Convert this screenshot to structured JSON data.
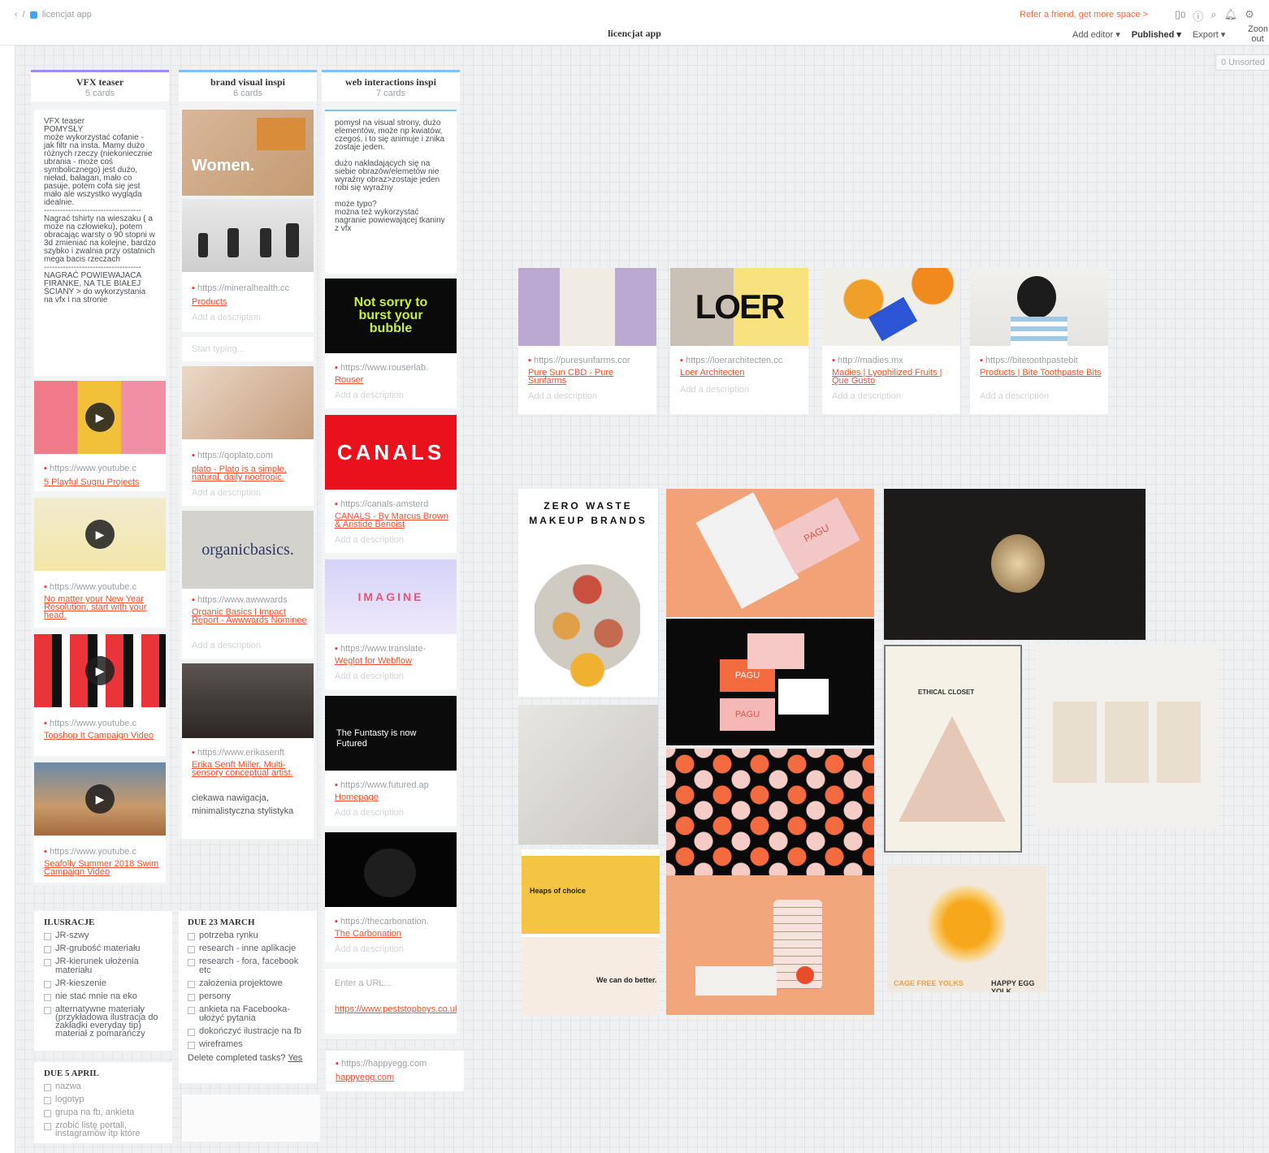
{
  "topbar": {
    "breadcrumb": "licencjat app",
    "title": "licencjat app",
    "refer": "Refer a friend, get more space >",
    "add_editor": "Add editor",
    "published": "Published",
    "export": "Export",
    "zoom": "Zoom out",
    "cards_count": "0",
    "unsorted": "0 Unsorted"
  },
  "col1": {
    "title": "VFX teaser",
    "count": "5 cards",
    "note1": "VFX teaser\nPOMYSŁY\nmoże wykorzystać cofanie - jak filtr na insta. Mamy dużo różnych rzeczy (niekoniecznie ubrania - może coś symbolicznego) jest dużo, nieład, bałagan, mało co pasuje, potem cofa się jest mało ale wszystko wygląda idealnie.\n------------------------------------\nNagrać tshirty na wieszaku ( a może na człowieku), potem obracając warsty o 90 stopni w 3d zmieniać na kolejne, bardzo szybko i zwalnia przy ostatnich mega bacis rzeczach\n------------------------------------\nNAGRAĆ POWIEWAJACA FIRANKE, NA TLE BIAŁEJ ŚCIANY > do wykorzystania na vfx i na stronie",
    "videos": [
      {
        "url": "https://www.youtube.c",
        "title": "5 Playful Sugru Projects"
      },
      {
        "url": "https://www.youtube.c",
        "title": "No matter your New Year Resolution, start with your head."
      },
      {
        "url": "https://www.youtube.c",
        "title": "Topshop It Campaign Video"
      },
      {
        "url": "https://www.youtube.c",
        "title": "Seafolly Summer 2018 Swim Campaign Video"
      }
    ]
  },
  "col2": {
    "title": "brand visual inspi",
    "count": "6 cards",
    "women": "Women.",
    "cards": [
      {
        "url": "https://mineralhealth.cc",
        "title": "Products",
        "desc": "Add a description"
      },
      {
        "url": "https://qoplato.com",
        "title": "plato - Plato is a simple, natural, daily nootropic.",
        "desc": "Add a description"
      },
      {
        "url": "https://www.awwwards",
        "title": "Organic Basics | Impact Report - Awwwards Nominee",
        "desc": "Add a description"
      },
      {
        "url": "https://www.erikasenft",
        "title": "Erika Senft Miller. Multi-sensory conceptual artist.",
        "extra": "ciekawa nawigacja, minimalistyczna stylistyka"
      }
    ],
    "start": "Start typing...",
    "organic": "organicbasics."
  },
  "col3": {
    "title": "web interactions inspi",
    "count": "7 cards",
    "note": "pomysł na visual strony, dużo elementów, może np kwiatów, czegoś, i to się animuje i znika zostaje jeden.\n\ndużo nakładających się na siebie obrazów/elemetów nie wyraźny obraz>zostaje jeden robi się wyraźny\n\nmoże typo?\nmożna też wykorzystać nagranie powiewającej tkaniny z vfx",
    "notsorry": "Not sorry to burst your bubble",
    "canals": "CANALS",
    "imagine": "IMAGINE",
    "futured": "The Funtasty is now Futured",
    "cards": [
      {
        "url": "https://www.rouserlab.",
        "title": "Rouser",
        "desc": "Add a description"
      },
      {
        "url": "https://canals-amsterd",
        "title": "CANALS - By Marcus Brown & Aristide Benoist",
        "desc": "Add a description"
      },
      {
        "url": "https://www.translate-",
        "title": "Weglot for Webflow",
        "desc": "Add a description"
      },
      {
        "url": "https://www.futured.ap",
        "title": "Homepage",
        "desc": "Add a description"
      },
      {
        "url": "https://thecarbonation.",
        "title": "The Carbonation",
        "desc": "Add a description"
      }
    ],
    "enter_url": "Enter a URL...",
    "peststop": "https://www.peststopboys.co.uk"
  },
  "happyegg": {
    "url": "https://happyegg.com",
    "title": "happyegg.com"
  },
  "tasks1": {
    "title": "ILUSRACJE",
    "items": [
      "JR-szwy",
      "JR-grubość materiału",
      "JR-kierunek ułożenia materiału",
      "JR-kieszenie",
      "nie stać mnie na eko",
      "alternatywne materiały (przykładowa ilustracja do zakładki everyday tip) materiał z pomarańczy"
    ]
  },
  "tasks2": {
    "title": "DUE 23 MARCH",
    "items": [
      "potrzeba rynku",
      "research - inne aplikacje",
      "research - fora, facebook etc",
      "założenia projektowe",
      "persony",
      "ankieta na Facebooka-ułożyć pytania",
      "dokończyć ilustracje na fb",
      "wireframes"
    ],
    "delete": "Delete completed tasks?",
    "yes": "Yes"
  },
  "tasks3": {
    "title": "DUE 5 APRIL",
    "items": [
      "nazwa",
      "logotyp",
      "grupa na fb, ankieta",
      "zrobić listę portali, instagramów itp które"
    ]
  },
  "bookmarks": [
    {
      "url": "https://puresunfarms.cor",
      "title": "Pure Sun CBD - Pure Sunfarms",
      "desc": "Add a description"
    },
    {
      "url": "https://loerarchitecten.cc",
      "title": "Loer Architecten",
      "desc": "Add a description",
      "logo": "LOER"
    },
    {
      "url": "http://madies.mx",
      "title": "Madies | Lyophilized Fruits | Que Gusto",
      "desc": "Add a description"
    },
    {
      "url": "https://bitetoothpastebit",
      "title": "Products | Bite Toothpaste Bits",
      "desc": "Add a description"
    }
  ],
  "images": {
    "zero_waste": "ZERO WASTE MAKEUP BRANDS",
    "pagu": "PAGU",
    "ethical": "ETHICAL CLOSET",
    "cage": "CAGE FREE YOLKS",
    "happy": "HAPPY EGG YOLK",
    "heaps": "Heaps of choice",
    "wecan": "We can do better."
  }
}
